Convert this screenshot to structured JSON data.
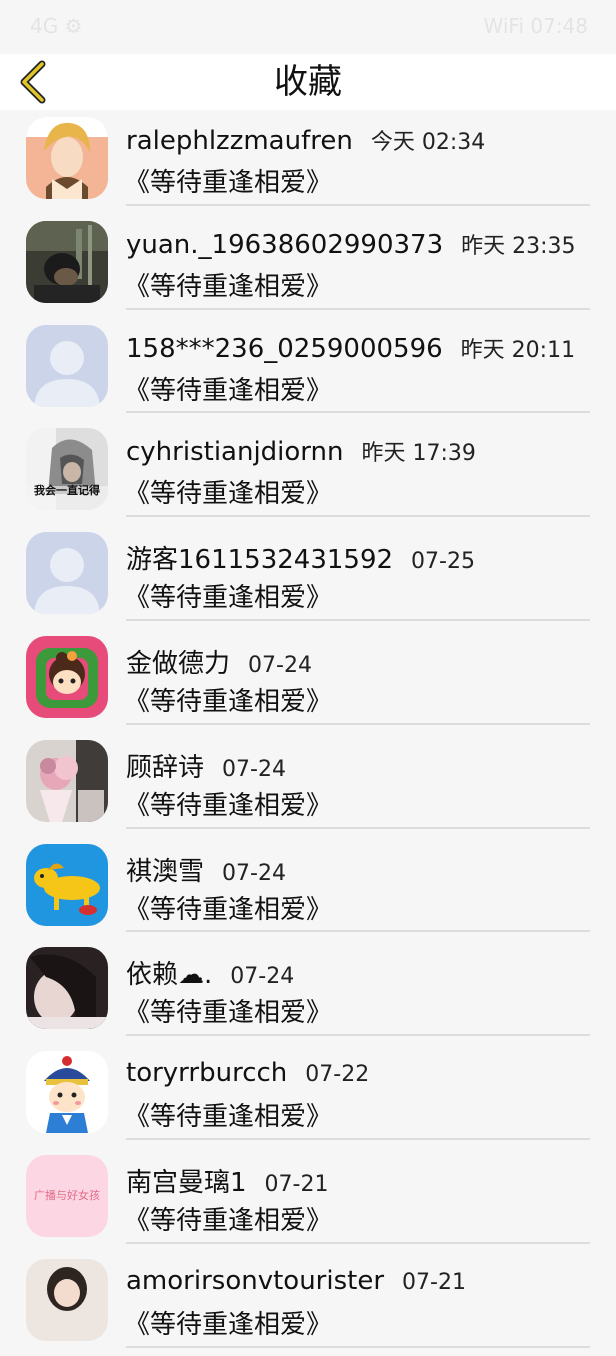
{
  "status_bar": {
    "left_text": "4G ⚙",
    "right_text": "WiFi 07:48"
  },
  "header": {
    "title": "收藏",
    "accent": "#e0c428"
  },
  "items": [
    {
      "name": "ralephlzzmaufren",
      "time": "今天 02:34",
      "book": "《等待重逢相爱》",
      "avatar": "anime-boy-blonde"
    },
    {
      "name": "yuan._19638602990373",
      "time": "昨天 23:35",
      "book": "《等待重逢相爱》",
      "avatar": "dark-photo-person"
    },
    {
      "name": "158***236_0259000596",
      "time": "昨天 20:11",
      "book": "《等待重逢相爱》",
      "avatar": "default-silhouette"
    },
    {
      "name": "cyhristianjdiornn",
      "time": "昨天 17:39",
      "book": "《等待重逢相爱》",
      "avatar": "hooded-person",
      "avatar_text": "我会一直记得"
    },
    {
      "name": "游客1611532431592",
      "time": "07-25",
      "book": "《等待重逢相爱》",
      "avatar": "default-silhouette"
    },
    {
      "name": "金做德力",
      "time": "07-24",
      "book": "《等待重逢相爱》",
      "avatar": "cartoon-girl-green"
    },
    {
      "name": "顾辞诗",
      "time": "07-24",
      "book": "《等待重逢相爱》",
      "avatar": "flower-bouquet"
    },
    {
      "name": "褀澳雪",
      "time": "07-24",
      "book": "《等待重逢相爱》",
      "avatar": "yellow-dog-blue"
    },
    {
      "name": "依赖☁︎.",
      "time": "07-24",
      "book": "《等待重逢相爱》",
      "avatar": "girl-dark-hair"
    },
    {
      "name": "toryrrburcch",
      "time": "07-22",
      "book": "《等待重逢相爱》",
      "avatar": "cartoon-qing-boy"
    },
    {
      "name": "南宫曼璃1",
      "time": "07-21",
      "book": "《等待重逢相爱》",
      "avatar": "pink-text",
      "avatar_text": "广播与好女孩"
    },
    {
      "name": "amorirsonvtourister",
      "time": "07-21",
      "book": "《等待重逢相爱》",
      "avatar": "girl-photo"
    }
  ]
}
